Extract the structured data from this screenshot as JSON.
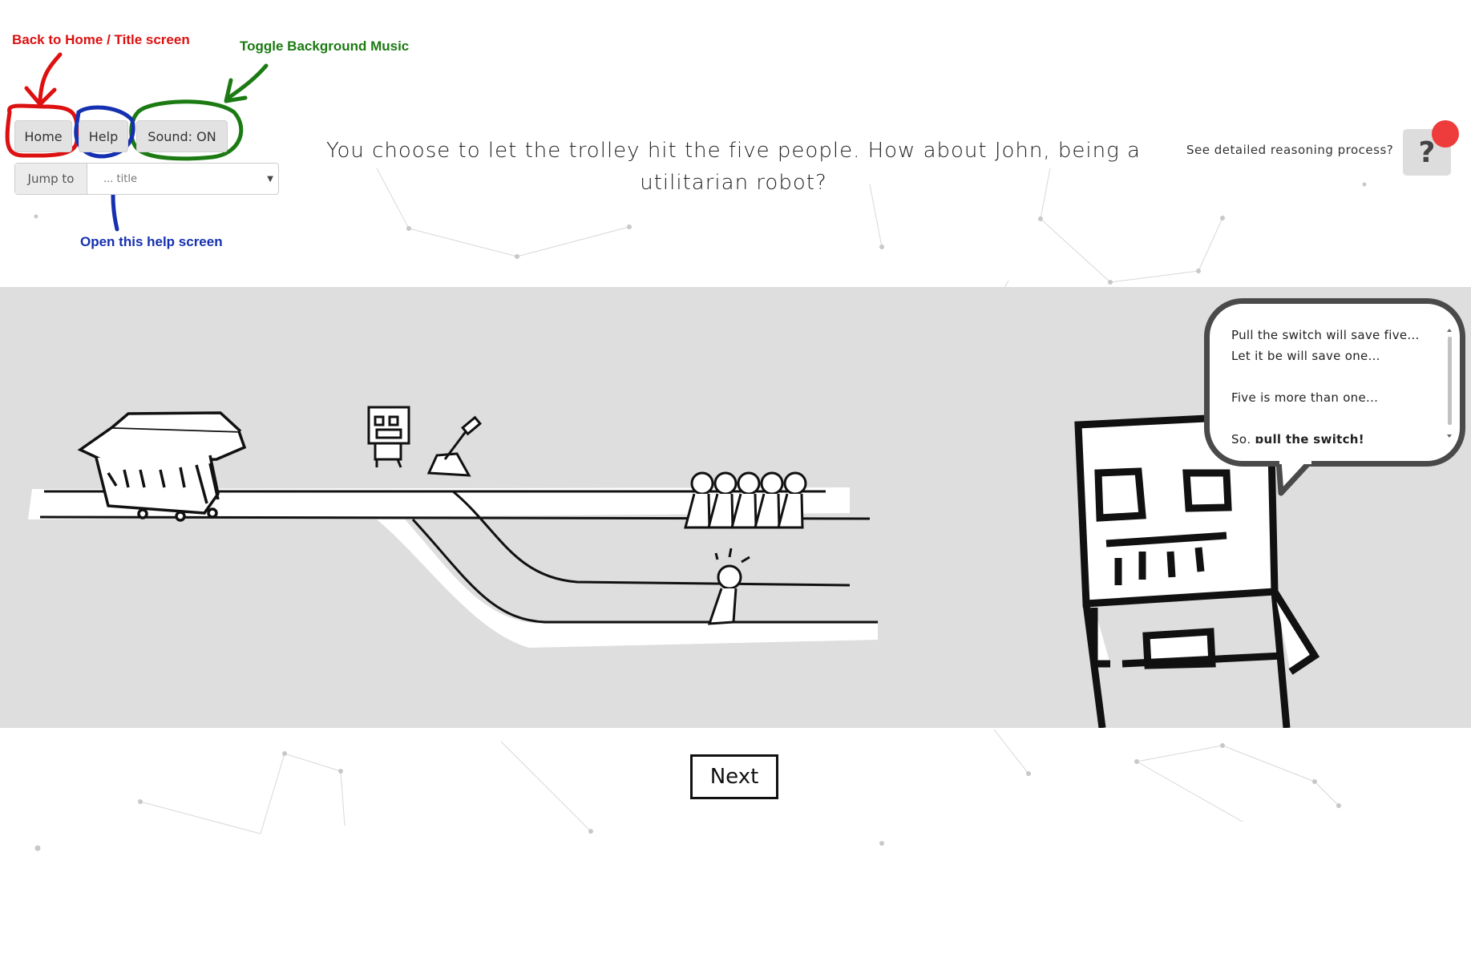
{
  "annotations": {
    "home_note": "Back to Home / Title screen",
    "music_note": "Toggle Background Music",
    "help_note": "Open this help screen"
  },
  "toolbar": {
    "home_label": "Home",
    "help_label": "Help",
    "sound_label": "Sound: ON",
    "jump_label": "Jump to",
    "jump_value": "... title"
  },
  "main": {
    "question": "You choose to let the trolley hit the five people. How about John, being a utilitarian robot?",
    "reasoning_link": "See detailed reasoning process?",
    "help_icon": "?"
  },
  "bubble": {
    "line1": "Pull the switch will save five...",
    "line2": "Let it be will save one...",
    "line3": "Five is more than one...",
    "line4_prefix": "So, ",
    "line4_bold": "pull the switch!"
  },
  "footer": {
    "next_label": "Next"
  },
  "colors": {
    "red_annotation": "#dd1111",
    "green_annotation": "#1b7a12",
    "blue_annotation": "#1530b0",
    "notification_dot": "#ee3b3b",
    "stage_bg": "#dedede"
  },
  "icons": {
    "help": "question-mark-icon",
    "dropdown": "chevron-down-icon"
  }
}
